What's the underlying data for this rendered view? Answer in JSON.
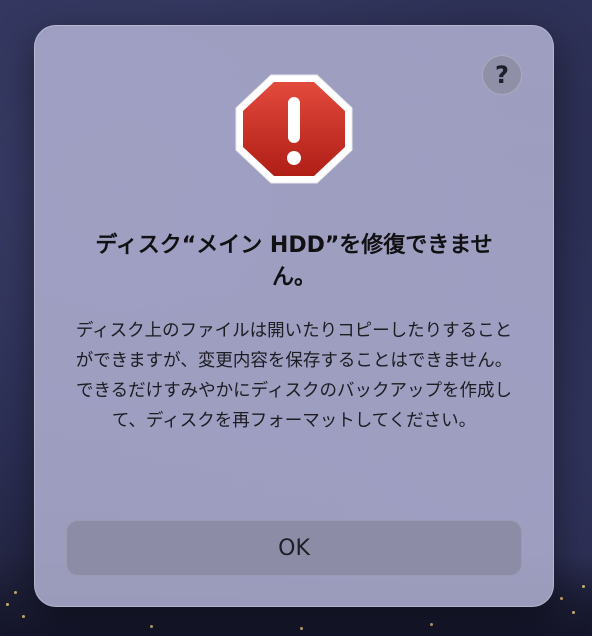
{
  "dialog": {
    "icon": "alert-octagon-icon",
    "help_button_label": "?",
    "title": "ディスク“メイン HDD”を修復できません。",
    "message": "ディスク上のファイルは開いたりコピーしたりすることができますが、変更内容を保存することはできません。できるだけすみやかにディスクのバックアップを作成して、ディスクを再フォーマットしてください。",
    "ok_label": "OK"
  },
  "colors": {
    "alert_red": "#c0281f",
    "dialog_bg": "#b0b0d2",
    "button_bg": "#8c8ca6"
  }
}
